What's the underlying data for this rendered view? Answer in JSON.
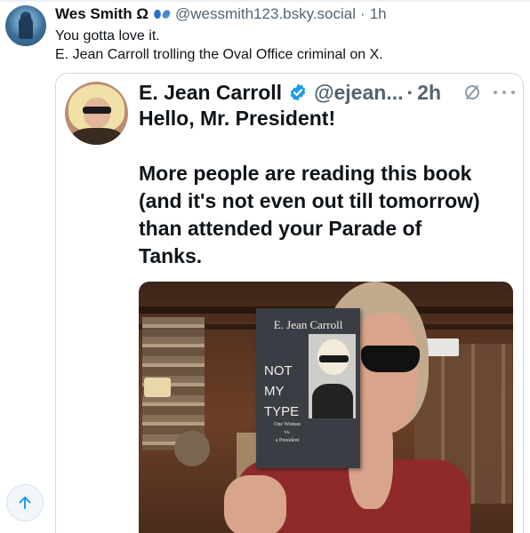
{
  "post": {
    "author_name": "Wes Smith Ω",
    "author_handle": "@wessmith123.bsky.social",
    "separator": "·",
    "time": "1h",
    "text_lines": [
      "You gotta love it.",
      "E. Jean Carroll trolling the Oval Office criminal on X."
    ]
  },
  "quote": {
    "author_name": "E. Jean Carroll",
    "author_handle": "@ejean...",
    "separator": "·",
    "time": "2h",
    "text_line_1": "Hello, Mr. President!",
    "text_lines_2": [
      "More people are reading this book",
      "(and it's not even out till tomorrow)",
      "than attended your Parade of",
      "Tanks."
    ],
    "book": {
      "author": "E. Jean Carroll",
      "title_lines": [
        "NOT",
        "MY",
        "TYPE"
      ],
      "subtitle_lines": [
        "One Woman",
        "vs.",
        "a President"
      ]
    }
  },
  "colors": {
    "accent": "#1d9bf0",
    "muted_text": "#536471",
    "border": "#cfd9de"
  },
  "icons": {
    "verified": "verified-badge-icon",
    "edited": "edited-icon",
    "more": "more-icon",
    "scroll_top": "arrow-up-icon",
    "butterfly": "butterfly-icon"
  }
}
